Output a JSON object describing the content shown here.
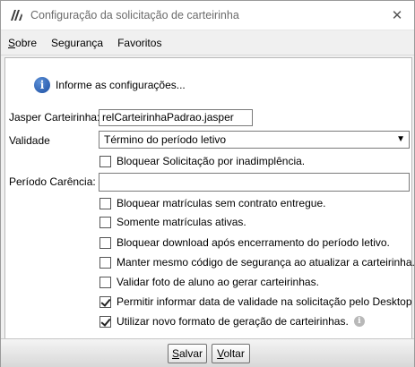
{
  "window": {
    "title": "Configuração da solicitação de carteirinha"
  },
  "menu": {
    "items": [
      "Sobre",
      "Segurança",
      "Favoritos"
    ]
  },
  "info": {
    "text": "Informe as configurações..."
  },
  "fields": {
    "jasper_label": "Jasper Carteirinha:",
    "jasper_value": "relCarteirinhaPadrao.jasper",
    "validade_label": "Validade",
    "validade_value": "Término do período letivo",
    "carencia_label": "Período Carência:",
    "carencia_value": ""
  },
  "checks": [
    {
      "label": "Bloquear Solicitação por inadimplência.",
      "checked": false
    },
    {
      "label": "Bloquear matrículas sem contrato entregue.",
      "checked": false
    },
    {
      "label": "Somente matrículas ativas.",
      "checked": false
    },
    {
      "label": "Bloquear download após encerramento do período letivo.",
      "checked": false
    },
    {
      "label": "Manter mesmo código de segurança ao atualizar a carteirinha.",
      "checked": false
    },
    {
      "label": "Validar foto de aluno ao gerar carteirinhas.",
      "checked": false
    },
    {
      "label": "Permitir informar data de validade na solicitação pelo Desktop",
      "checked": true
    },
    {
      "label": "Utilizar novo formato de geração de carteirinhas.",
      "checked": true
    }
  ],
  "buttons": {
    "save": "Salvar",
    "back": "Voltar"
  },
  "icons": {
    "app": "app-logo-icon",
    "close": "close-icon",
    "info": "info-icon",
    "help": "help-info-icon"
  },
  "colors": {
    "info_blue": "#1d4fa3",
    "panel_bg": "#ffffff",
    "window_bg": "#f0f0f0"
  }
}
